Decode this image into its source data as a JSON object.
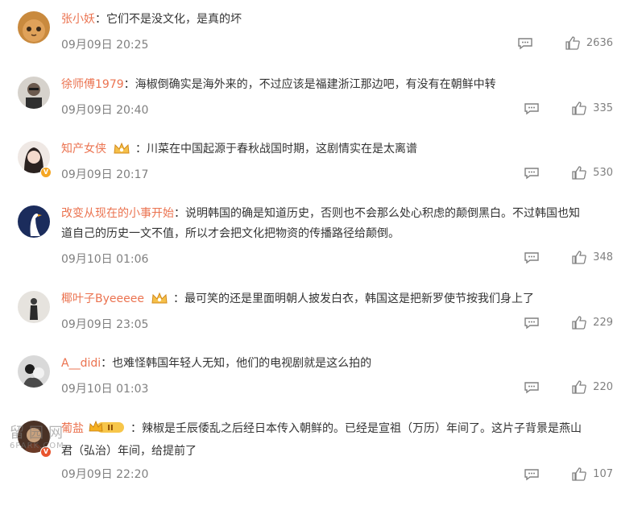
{
  "comments": [
    {
      "user": "张小妖",
      "text": "：它们不是没文化，是真的坏",
      "time": "09月09日 20:25",
      "likes": "2636"
    },
    {
      "user": "徐师傅1979",
      "text": "：海椒倒确实是海外来的，不过应该是福建浙江那边吧，有没有在朝鲜中转",
      "time": "09月09日 20:40",
      "likes": "335"
    },
    {
      "user": "知产女侠",
      "text": "：川菜在中国起源于春秋战国时期，这剧情实在是太离谱",
      "time": "09月09日 20:17",
      "likes": "530"
    },
    {
      "user": "改变从现在的小事开始",
      "text": "：说明韩国的确是知道历史，否则也不会那么处心积虑的颠倒黑白。不过韩国也知",
      "text2": "道自己的历史一文不值，所以才会把文化把物资的传播路径给颠倒。",
      "time": "09月10日 01:06",
      "likes": "348"
    },
    {
      "user": "椰叶子Byeeeee",
      "text": "：最可笑的还是里面明朝人披发白衣，韩国这是把新罗使节按我们身上了",
      "time": "09月09日 23:05",
      "likes": "229"
    },
    {
      "user": "A__didi",
      "text": "：也难怪韩国年轻人无知，他们的电视剧就是这么拍的",
      "time": "09月10日 01:03",
      "likes": "220"
    },
    {
      "user": "葡盐",
      "text": "：辣椒是壬辰倭乱之后经日本传入朝鲜的。已经是宣祖（万历）年间了。这片子背景是燕山",
      "text2": "君（弘治）年间，给提前了",
      "time": "09月09日 22:20",
      "likes": "107",
      "level": "II"
    }
  ],
  "watermark": {
    "main": "留园网",
    "sub": "6PARK.COM"
  },
  "colors": {
    "name": "#eb7350",
    "time": "#808080",
    "text": "#333333",
    "crown": "#f5a623"
  },
  "icons": {
    "reply": "reply-icon",
    "like": "like-icon",
    "crown": "crown-badge-icon",
    "verified": "verified-badge-icon"
  }
}
